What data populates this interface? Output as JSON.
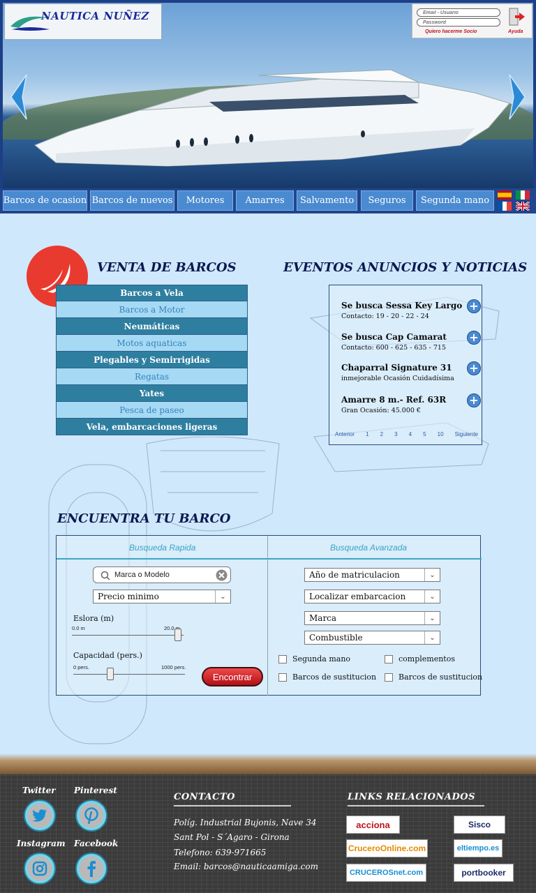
{
  "header": {
    "logo_text": "NAUTICA NUÑEZ",
    "login": {
      "email_placeholder": "Email - Usuario",
      "password_placeholder": "Password",
      "join_link": "Quiero hacerme Socio",
      "help_link": "Ayuda"
    }
  },
  "nav": {
    "tabs": [
      "Barcos de ocasion",
      "Barcos de nuevos",
      "Motores",
      "Amarres",
      "Salvamento",
      "Seguros",
      "Segunda mano"
    ],
    "languages": [
      "es-flag-icon",
      "it-flag-icon",
      "fr-flag-icon",
      "uk-flag-icon"
    ]
  },
  "venta": {
    "title": "VENTA DE BARCOS",
    "categories": [
      "Barcos a Vela",
      "Barcos a Motor",
      "Neumáticas",
      "Motos aquaticas",
      "Plegables y Semirrigidas",
      "Regatas",
      "Yates",
      "Pesca de paseo",
      "Vela, embarcaciones ligeras"
    ]
  },
  "eventos": {
    "title": "EVENTOS ANUNCIOS Y NOTICIAS",
    "items": [
      {
        "title": "Se busca Sessa Key Largo",
        "sub": "Contacto: 19 - 20 - 22 - 24"
      },
      {
        "title": "Se busca Cap Camarat",
        "sub": "Contacto: 600 -  625 -  635 - 715"
      },
      {
        "title": "Chaparral Signature 31",
        "sub": "inmejorable Ocasión Cuidadísima"
      },
      {
        "title": "Amarre 8 m.- Ref. 63R",
        "sub": "Gran Ocasión: 45.000 €"
      }
    ],
    "pager": {
      "prev": "Anterior",
      "pages": [
        "1",
        "2",
        "3",
        "4",
        "5",
        "10"
      ],
      "next": "Siguiente"
    }
  },
  "search": {
    "title": "ENCUENTRA TU BARCO",
    "quick": {
      "label": "Busqueda Rapida",
      "keyword_placeholder": "Marca o Modelo",
      "price_select": "Precio minimo",
      "eslora_label": "Eslora (m)",
      "eslora_min": "0.0 m",
      "eslora_max": "20.0 m",
      "eslora_value_fraction": 0.95,
      "capacidad_label": "Capacidad (pers.)",
      "capacidad_min": "0 pers.",
      "capacidad_max": "1000 pers.",
      "capacidad_value_fraction": 0.33,
      "find_button": "Encontrar"
    },
    "advanced": {
      "label": "Busqueda Avanzada",
      "selects": [
        "Año de matriculacion",
        "Localizar embarcacion",
        "Marca",
        "Combustible"
      ],
      "checkboxes": [
        "Segunda mano",
        "complementos",
        "Barcos de sustitucion",
        "Barcos de sustitucion"
      ]
    }
  },
  "footer": {
    "social": [
      {
        "label": "Twitter",
        "icon": "twitter-icon"
      },
      {
        "label": "Pinterest",
        "icon": "pinterest-icon"
      },
      {
        "label": "Instagram",
        "icon": "instagram-icon"
      },
      {
        "label": "Facebook",
        "icon": "facebook-icon"
      }
    ],
    "contact": {
      "title": "CONTACTO",
      "lines": [
        "Políg. Industrial Bujonis, Nave 34",
        "Sant Pol - S´Agaro - Girona",
        "Telefono:    639-971665",
        "Email:    barcos@nauticaamiga.com"
      ]
    },
    "links": {
      "title": "LINKS RELACIONADOS",
      "items": [
        "acciona",
        "Sisco",
        "CruceroOnline.com",
        "eltiempo.es",
        "CRUCEROSnet.com",
        "portbooker"
      ]
    }
  },
  "colors": {
    "nav_bg": "#21458e",
    "tab_bg": "#4a8ad0",
    "accent_red": "#e93a2f",
    "cat_dark": "#2e7ea0",
    "cat_light": "#a6d9f3"
  }
}
